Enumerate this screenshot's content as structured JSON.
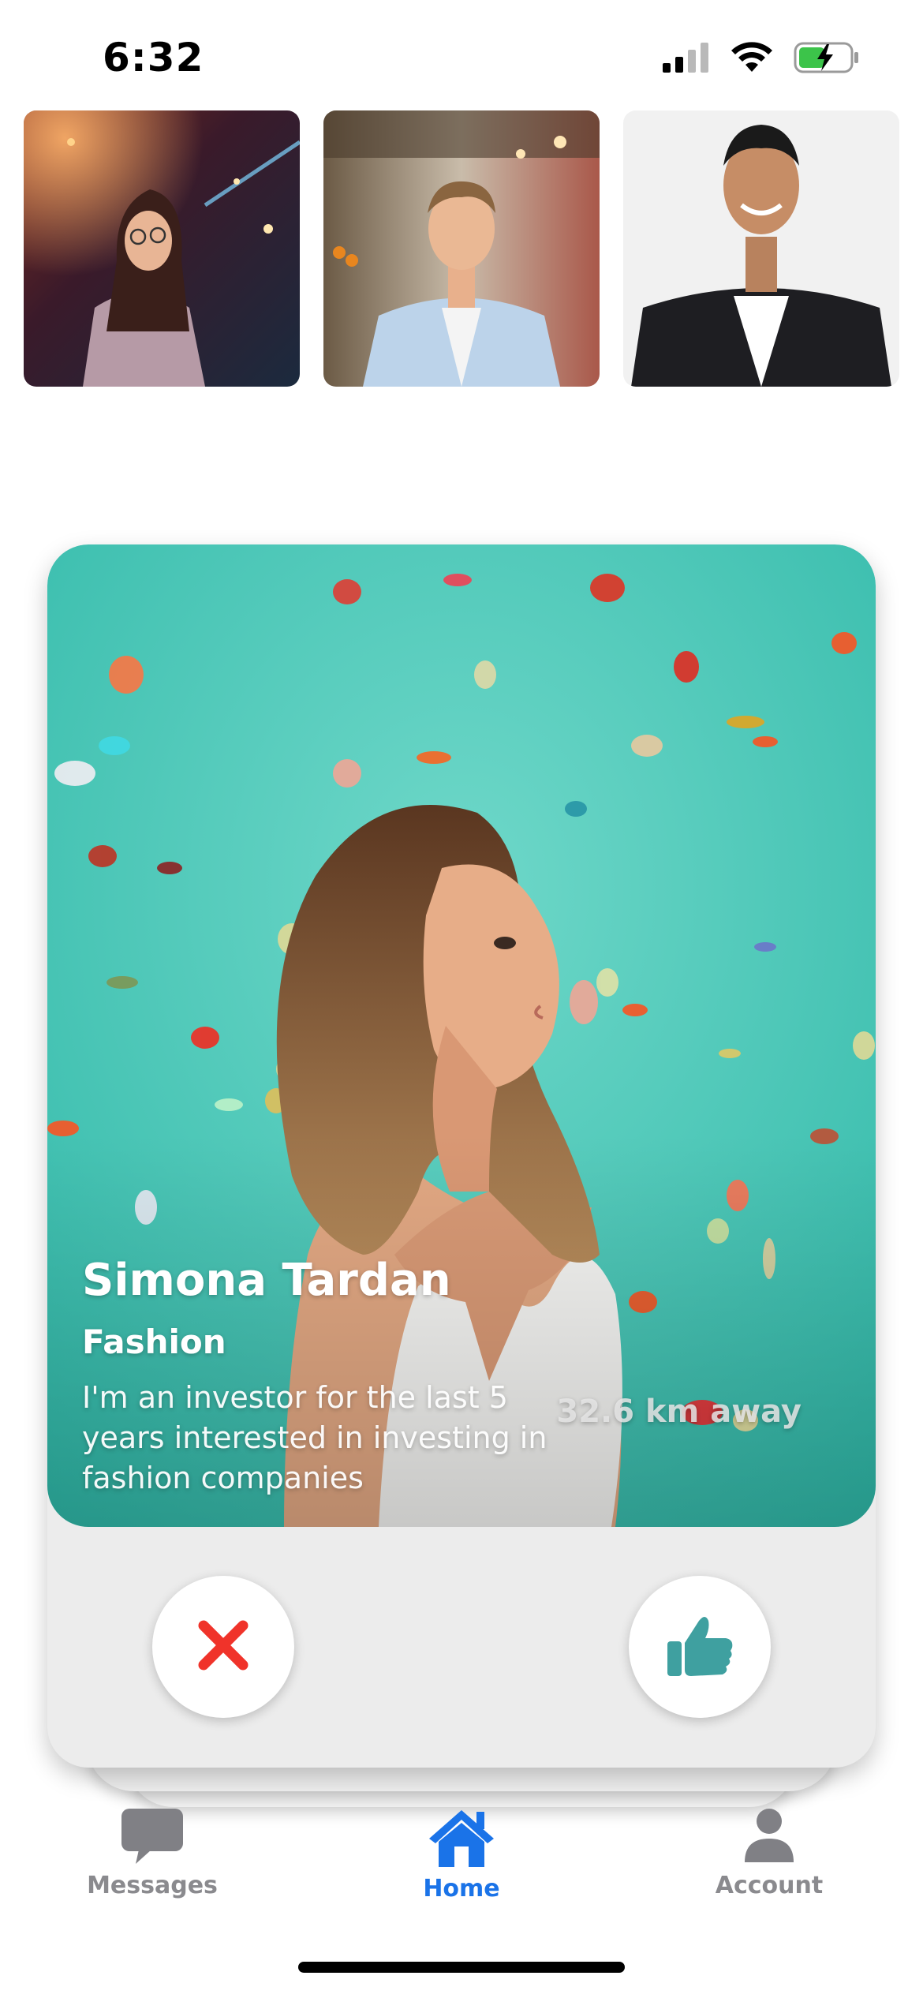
{
  "status_bar": {
    "time": "6:32"
  },
  "profile_card": {
    "name": "Simona Tardan",
    "category": "Fashion",
    "bio": "I'm an investor for the last 5 years interested in investing in fashion companies",
    "distance": "32.6 km away"
  },
  "actions": {
    "dislike_icon": "close-x-icon",
    "like_icon": "thumbs-up-icon"
  },
  "tab_bar": {
    "tabs": [
      {
        "label": "Messages",
        "icon": "chat-bubble-icon",
        "active": false
      },
      {
        "label": "Home",
        "icon": "house-icon",
        "active": true
      },
      {
        "label": "Account",
        "icon": "person-icon",
        "active": false
      }
    ]
  },
  "colors": {
    "accent": "#1a73e8",
    "inactive": "#8a8a8e",
    "dislike": "#f0332a",
    "like": "#3fa0a0",
    "card_photo_bg": "#4fcbbb"
  }
}
